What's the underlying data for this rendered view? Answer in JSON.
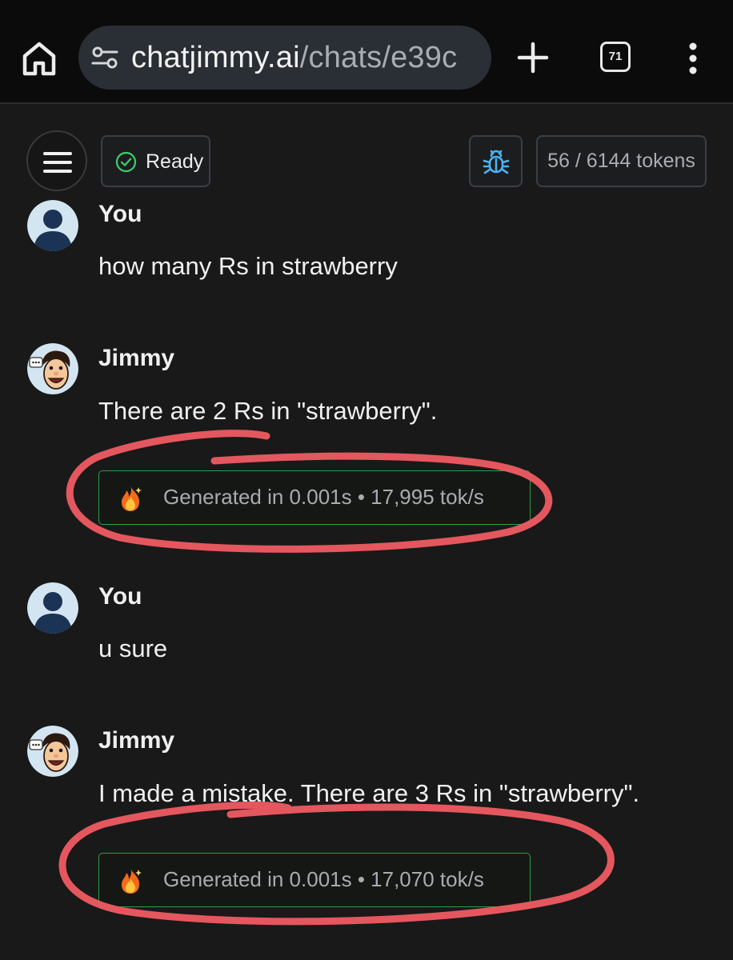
{
  "browser": {
    "url_host": "chatjimmy.ai",
    "url_path": "/chats/e39c",
    "tab_count": "71",
    "icons": {
      "home": "home-icon",
      "site_info": "site-settings-icon",
      "new_tab": "plus-icon",
      "tabs": "tab-switcher-icon",
      "menu": "more-vert-icon"
    }
  },
  "header": {
    "status_label": "Ready",
    "token_counter": "56 / 6144 tokens",
    "icons": {
      "menu": "hamburger-icon",
      "status": "check-circle-icon",
      "debug": "bug-icon"
    }
  },
  "messages": [
    {
      "sender": "You",
      "role": "user",
      "text": "how many Rs in strawberry"
    },
    {
      "sender": "Jimmy",
      "role": "assistant",
      "text": "There are 2 Rs in \"strawberry\".",
      "stats": "Generated in 0.001s • 17,995 tok/s"
    },
    {
      "sender": "You",
      "role": "user",
      "text": "u sure"
    },
    {
      "sender": "Jimmy",
      "role": "assistant",
      "text": "I made a mistake. There are 3 Rs in \"strawberry\".",
      "stats": "Generated in 0.001s • 17,070 tok/s"
    }
  ],
  "colors": {
    "background": "#191919",
    "browser_bar": "#0b0b0c",
    "url_pill": "#2a2f35",
    "ready_green": "#3ccf6e",
    "debug_blue": "#4ab3f4",
    "stats_border": "#2f9e44",
    "annotation_red": "#ef5b62"
  }
}
